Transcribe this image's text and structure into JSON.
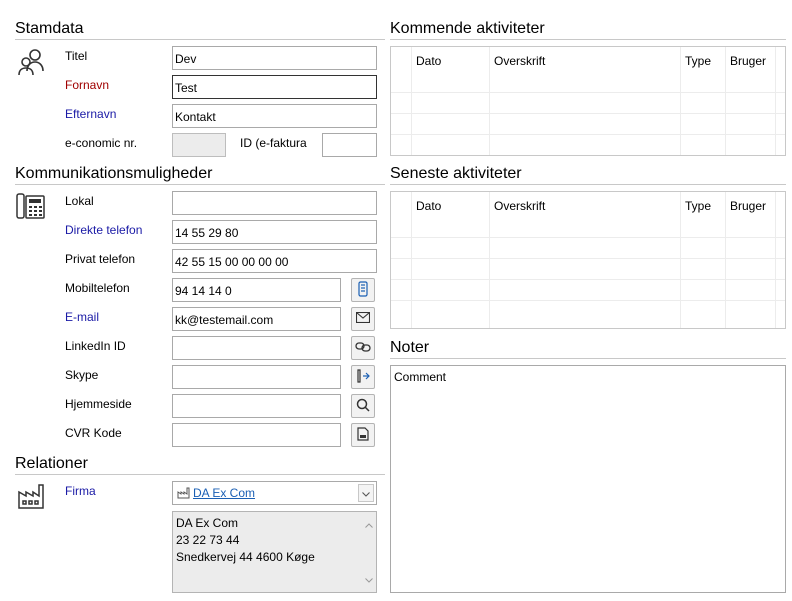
{
  "stamdata": {
    "title": "Stamdata",
    "titel_label": "Titel",
    "titel_value": "Dev",
    "fornavn_label": "Fornavn",
    "fornavn_value": "Test",
    "efternavn_label": "Efternavn",
    "efternavn_value": "Kontakt",
    "economic_label": "e-conomic nr.",
    "economic_value": "",
    "efaktura_label": "ID (e-faktura",
    "efaktura_value": ""
  },
  "kommunikation": {
    "title": "Kommunikationsmuligheder",
    "lokal_label": "Lokal",
    "lokal_value": "",
    "direkte_label": "Direkte telefon",
    "direkte_value": "14 55 29 80",
    "privat_label": "Privat telefon",
    "privat_value": "42 55 15 00 00 00 00",
    "mobil_label": "Mobiltelefon",
    "mobil_value": "94 14 14 0",
    "email_label": "E-mail",
    "email_value": "kk@testemail.com",
    "linkedin_label": "LinkedIn ID",
    "linkedin_value": "",
    "skype_label": "Skype",
    "skype_value": "",
    "hjemmeside_label": "Hjemmeside",
    "hjemmeside_value": "",
    "cvr_label": "CVR Kode",
    "cvr_value": ""
  },
  "relationer": {
    "title": "Relationer",
    "firma_label": "Firma",
    "firma_value": "DA Ex Com",
    "address_lines": [
      "DA Ex Com",
      "23 22 73 44",
      "Snedkervej 44  4600 Køge"
    ]
  },
  "kommende": {
    "title": "Kommende aktiviteter",
    "columns": [
      "Dato",
      "Overskrift",
      "Type",
      "Bruger"
    ]
  },
  "seneste": {
    "title": "Seneste aktiviteter",
    "columns": [
      "Dato",
      "Overskrift",
      "Type",
      "Bruger"
    ]
  },
  "noter": {
    "title": "Noter",
    "text": "Comment"
  },
  "icons": {
    "contacts": "people-icon",
    "phone": "desk-phone-icon",
    "factory": "factory-icon"
  }
}
